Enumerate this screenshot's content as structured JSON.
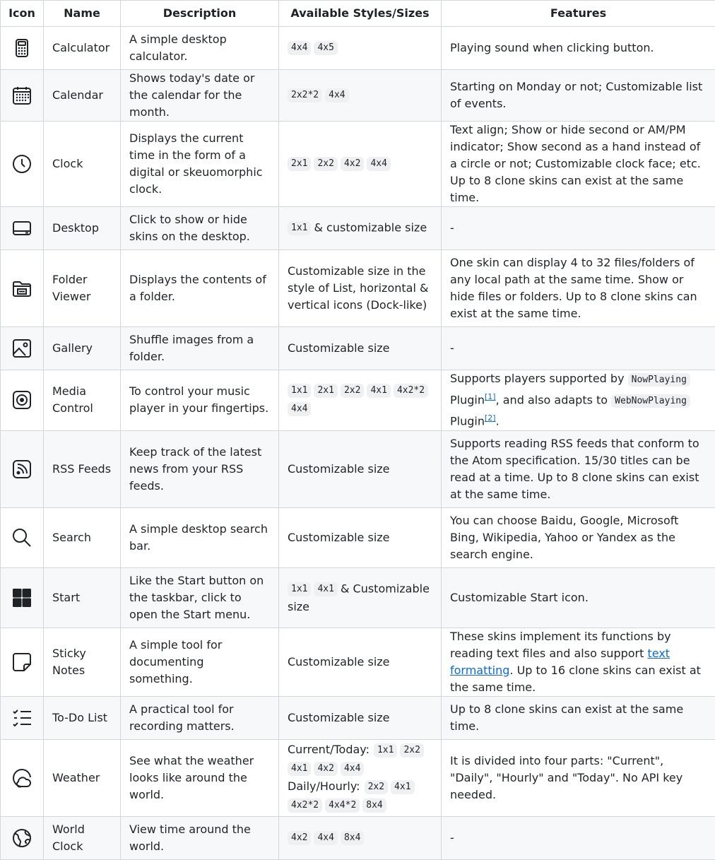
{
  "headers": [
    "Icon",
    "Name",
    "Description",
    "Available Styles/Sizes",
    "Features"
  ],
  "rows": [
    {
      "icon": "calculator-icon",
      "name": "Calculator",
      "description": "A simple desktop calculator.",
      "sizes": [
        "4x4",
        "4x5"
      ],
      "features": "Playing sound when clicking button."
    },
    {
      "icon": "calendar-icon",
      "name": "Calendar",
      "description": "Shows today's date or the calendar for the month.",
      "sizes": [
        "2x2*2",
        "4x4"
      ],
      "features": "Starting on Monday or not; Customizable list of events."
    },
    {
      "icon": "clock-icon",
      "name": "Clock",
      "description": "Displays the current time in the form of a digital or skeuomorphic clock.",
      "sizes": [
        "2x1",
        "2x2",
        "4x2",
        "4x4"
      ],
      "features": "Text align; Show or hide second or AM/PM indicator; Show second as a hand instead of a circle or not; Customizable clock face; etc. Up to 8 clone skins can exist at the same time."
    },
    {
      "icon": "desktop-icon",
      "name": "Desktop",
      "description": "Click to show or hide skins on the desktop.",
      "sizes": [
        "1x1"
      ],
      "sizes_suffix": "& customizable size",
      "features": "-"
    },
    {
      "icon": "folder-viewer-icon",
      "name": "Folder Viewer",
      "description": "Displays the contents of a folder.",
      "sizes_text": "Customizable size in the style of List, horizontal & vertical icons (Dock-like)",
      "features": "One skin can display 4 to 32 files/folders of any local path at the same time. Show or hide files or folders. Up to 8 clone skins can exist at the same time."
    },
    {
      "icon": "gallery-icon",
      "name": "Gallery",
      "description": "Shuffle images from a folder.",
      "sizes_text": "Customizable size",
      "features": "-"
    },
    {
      "icon": "media-control-icon",
      "name": "Media Control",
      "description": "To control your music player in your fingertips.",
      "sizes": [
        "1x1",
        "2x1",
        "2x2",
        "4x1",
        "4x2*2",
        "4x4"
      ],
      "features_parts": {
        "a": "Supports players supported by ",
        "code1": "NowPlaying",
        "b": " Plugin",
        "ref1": "[1]",
        "c": ", and also adapts to ",
        "code2": "WebNowPlaying",
        "d": " Plugin",
        "ref2": "[2]",
        "e": "."
      }
    },
    {
      "icon": "rss-icon",
      "name": "RSS Feeds",
      "description": "Keep track of the latest news from your RSS feeds.",
      "sizes_text": "Customizable size",
      "features": "Supports reading RSS feeds that conform to the Atom specification. 15/30 titles can be read at a time. Up to 8 clone skins can exist at the same time."
    },
    {
      "icon": "search-icon",
      "name": "Search",
      "description": "A simple desktop search bar.",
      "sizes_text": "Customizable size",
      "features": "You can choose Baidu, Google, Microsoft Bing, Wikipedia, Yahoo or Yandex as the search engine."
    },
    {
      "icon": "start-icon",
      "name": "Start",
      "description": "Like the Start button on the taskbar, click to open the Start menu.",
      "sizes": [
        "1x1",
        "4x1"
      ],
      "sizes_suffix": "& Customizable size",
      "features": "Customizable Start icon."
    },
    {
      "icon": "sticky-notes-icon",
      "name": "Sticky Notes",
      "description": "A simple tool for documenting something.",
      "sizes_text": "Customizable size",
      "features_parts": {
        "a": "These skins implement its functions by reading text files and also support ",
        "link": "text formatting",
        "b": ". Up to 16 clone skins can exist at the same time."
      }
    },
    {
      "icon": "todo-list-icon",
      "name": "To-Do List",
      "description": "A practical tool for recording matters.",
      "sizes_text": "Customizable size",
      "features": "Up to 8 clone skins can exist at the same time."
    },
    {
      "icon": "weather-icon",
      "name": "Weather",
      "description": "See what the weather looks like around the world.",
      "sizes_groups": [
        {
          "label": "Current/Today:",
          "sizes": [
            "1x1",
            "2x2",
            "4x1",
            "4x2",
            "4x4"
          ]
        },
        {
          "label": "Daily/Hourly:",
          "sizes": [
            "2x2",
            "4x1",
            "4x2*2",
            "4x4*2",
            "8x4"
          ]
        }
      ],
      "features": "It is divided into four parts: \"Current\", \"Daily\", \"Hourly\" and \"Today\". No API key needed."
    },
    {
      "icon": "world-clock-icon",
      "name": "World Clock",
      "description": "View time around the world.",
      "sizes": [
        "4x2",
        "4x4",
        "8x4"
      ],
      "features": "-"
    }
  ]
}
